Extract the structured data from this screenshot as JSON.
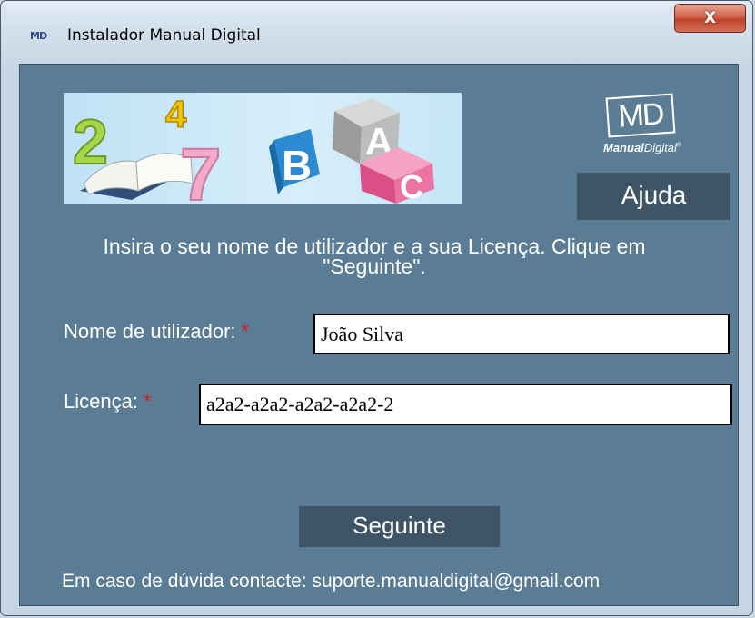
{
  "window": {
    "title": "Instalador Manual Digital",
    "icon_text": "MD",
    "close_label": "X"
  },
  "banner": {
    "numbers": [
      "2",
      "4",
      "7"
    ],
    "letters": [
      "A",
      "B",
      "C"
    ]
  },
  "brand": {
    "logo_text": "MD",
    "name_bold": "Manual",
    "name_regular": "Digital",
    "mark": "®"
  },
  "buttons": {
    "help": "Ajuda",
    "next": "Seguinte"
  },
  "instructions": {
    "line1": "Insira o seu nome de utilizador e a sua Licença. Clique em",
    "line2": "\"Seguinte\"."
  },
  "form": {
    "username_label": "Nome de utilizador:",
    "username_value": "João Silva",
    "license_label": "Licença:",
    "license_value": "a2a2-a2a2-a2a2-a2a2-2",
    "required_marker": "*"
  },
  "footer": {
    "contact_text": "Em caso de dúvida contacte: suporte.manualdigital@gmail.com"
  },
  "colors": {
    "panel": "#5b7c95",
    "button": "#3d5566",
    "required": "#d32020",
    "close": "#c0432a"
  }
}
